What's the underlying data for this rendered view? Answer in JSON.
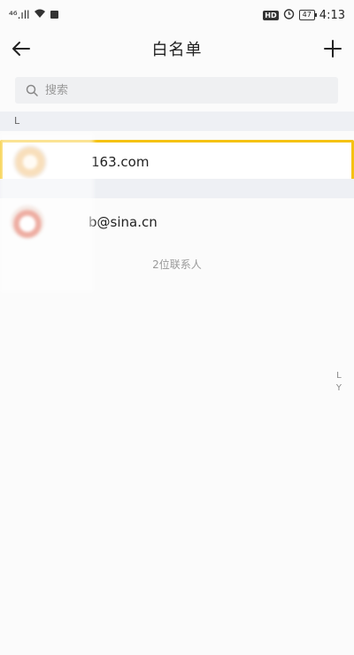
{
  "status_bar": {
    "signal": "⁴⁶.ıll",
    "hd": "HD",
    "battery": "47",
    "time": "4:13"
  },
  "header": {
    "title": "白名单"
  },
  "search": {
    "placeholder": "搜索"
  },
  "sections": [
    {
      "letter": "L"
    },
    {
      "letter": ""
    }
  ],
  "contacts": [
    {
      "email": "163.com",
      "selected": true,
      "avatar": "orange"
    },
    {
      "email": "b@sina.cn",
      "selected": false,
      "avatar": "red"
    }
  ],
  "count_text": "2位联系人",
  "index": [
    "L",
    "Y"
  ],
  "colors": {
    "accent": "#f5c213",
    "section_bg": "#eef0f4",
    "search_bg": "#eff0f2"
  }
}
